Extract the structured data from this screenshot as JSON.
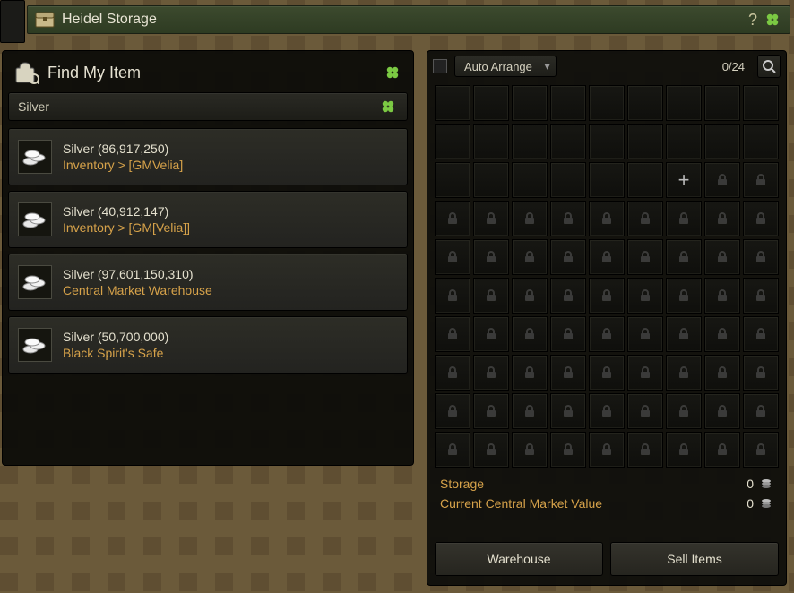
{
  "titlebar": {
    "title": "Heidel Storage"
  },
  "find": {
    "header": "Find My Item",
    "search_value": "Silver"
  },
  "results": [
    {
      "name": "Silver (86,917,250)",
      "location": "Inventory > [GMVelia]"
    },
    {
      "name": "Silver (40,912,147)",
      "location": "Inventory > [GM[Velia]]"
    },
    {
      "name": "Silver (97,601,150,310)",
      "location": "Central Market Warehouse"
    },
    {
      "name": "Silver (50,700,000)",
      "location": "Black Spirit's Safe"
    }
  ],
  "storage": {
    "auto_arrange_label": "Auto Arrange",
    "slot_count": "0/24",
    "rows": [
      "EEEEEEEEE",
      "EEEEEEEEE",
      "EEEEEEPLL",
      "LLLLLLLLL",
      "LLLLLLLLL",
      "LLLLLLLLL",
      "LLLLLLLLL",
      "LLLLLLLLL",
      "LLLLLLLLL",
      "LLLLLLLLL"
    ],
    "storage_label": "Storage",
    "storage_value": "0",
    "cmv_label": "Current Central Market Value",
    "cmv_value": "0",
    "warehouse_btn": "Warehouse",
    "sell_btn": "Sell Items"
  }
}
